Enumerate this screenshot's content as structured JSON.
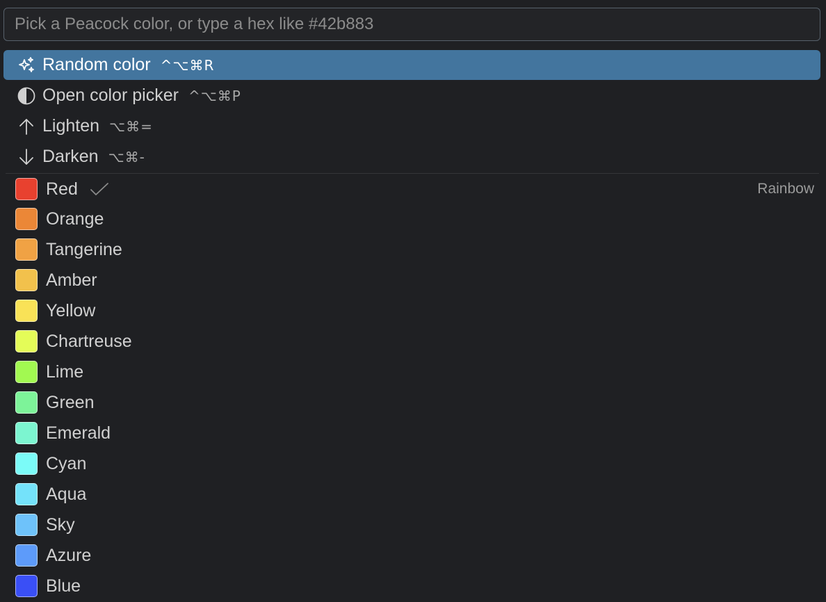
{
  "search": {
    "placeholder": "Pick a Peacock color, or type a hex like #42b883",
    "value": ""
  },
  "actions": [
    {
      "label": "Random color",
      "shortcut": "^⌥⌘R",
      "icon": "sparkle-icon",
      "active": true
    },
    {
      "label": "Open color picker",
      "shortcut": "^⌥⌘P",
      "icon": "half-circle-icon",
      "active": false
    },
    {
      "label": "Lighten",
      "shortcut": "⌥⌘=",
      "icon": "arrow-up-icon",
      "active": false
    },
    {
      "label": "Darken",
      "shortcut": "⌥⌘-",
      "icon": "arrow-down-icon",
      "active": false
    }
  ],
  "colors": {
    "group_label": "Rainbow",
    "items": [
      {
        "name": "Red",
        "hex": "#e8412f",
        "checked": true
      },
      {
        "name": "Orange",
        "hex": "#eb8737"
      },
      {
        "name": "Tangerine",
        "hex": "#f0a244"
      },
      {
        "name": "Amber",
        "hex": "#f2c14c"
      },
      {
        "name": "Yellow",
        "hex": "#f9e257"
      },
      {
        "name": "Chartreuse",
        "hex": "#e4fc58"
      },
      {
        "name": "Lime",
        "hex": "#a2f951"
      },
      {
        "name": "Green",
        "hex": "#7df399"
      },
      {
        "name": "Emerald",
        "hex": "#7cf5d0"
      },
      {
        "name": "Cyan",
        "hex": "#7bfbf8"
      },
      {
        "name": "Aqua",
        "hex": "#74e2fa"
      },
      {
        "name": "Sky",
        "hex": "#6ec2fa"
      },
      {
        "name": "Azure",
        "hex": "#5d9bfa"
      },
      {
        "name": "Blue",
        "hex": "#3a4ff6"
      }
    ]
  },
  "theme": {
    "background": "#1f2023",
    "active_row": "#43759e",
    "input_border": "#57616b"
  }
}
